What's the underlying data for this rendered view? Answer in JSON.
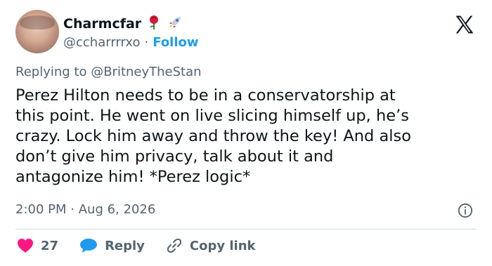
{
  "user": {
    "name": "Charmcfar",
    "handle": "@ccharrrrxo",
    "separator": "·",
    "follow_label": "Follow"
  },
  "reply": {
    "prefix": "Replying to ",
    "to": "@BritneyTheStan"
  },
  "tweet": {
    "text": "Perez Hilton needs to be in a conservatorship at\nthis point. He went on live slicing himself up, he’s\ncrazy. Lock him away and throw the key! And also\ndon’t give him privacy, talk about it and\nantagonize him! *Perez logic*"
  },
  "meta": {
    "time": "2:00 PM",
    "separator": "·",
    "date": "Aug 6, 2026"
  },
  "actions": {
    "like_count": "27",
    "reply_label": "Reply",
    "copy_link_label": "Copy link"
  },
  "colors": {
    "like": "#f91880",
    "reply": "#1d9bf0",
    "follow": "#1d9bf0",
    "muted": "#536471"
  },
  "icons": [
    "rose-emoji-icon",
    "rocket-emoji-icon",
    "x-logo-icon",
    "info-icon",
    "heart-icon",
    "reply-bubble-icon",
    "link-icon"
  ]
}
